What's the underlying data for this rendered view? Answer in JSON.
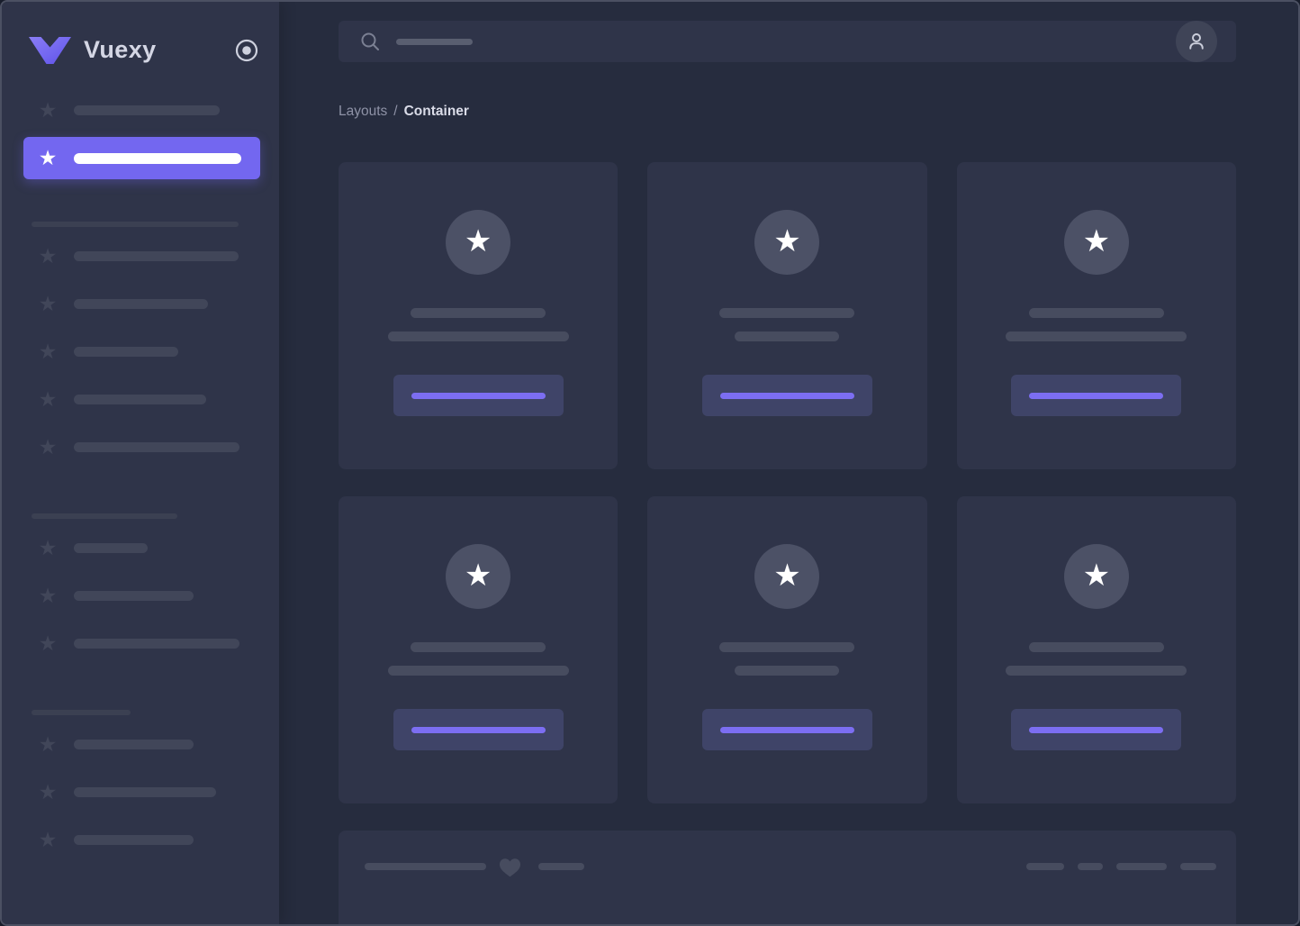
{
  "theme": {
    "accent": "#7367f0",
    "main_bg": "#262c3e",
    "panel_bg": "#2f3449",
    "window_border": "#4b5062",
    "sk_bar": "#414659",
    "sk_bar_dim": "#3b4052",
    "card_bar": "#474c5f",
    "circle_bg": "#4c5166",
    "btn_bg": "#3f4468",
    "btn_bar": "#7c6ef2",
    "avatar_bg": "#3f4457",
    "text_primary": "#d4d6e4",
    "text_muted": "#8e92a6"
  },
  "icons": {
    "star_glyph": "★",
    "brand_logo": "vuexy-v-chevron",
    "sidebar_toggle": "radio-circle",
    "menu_item": "star",
    "search": "magnifier",
    "user": "person-silhouette",
    "footer": "heart"
  },
  "sidebar": {
    "brand": "Vuexy",
    "menu": {
      "top_item_bar_width": 162,
      "active_item_bar_width": 186,
      "sections": [
        {
          "header_bar_width": 230,
          "item_bar_widths": [
            183,
            149,
            116,
            147,
            184
          ]
        },
        {
          "header_bar_width": 162,
          "item_bar_widths": [
            82,
            133,
            184
          ]
        },
        {
          "header_bar_width": 110,
          "item_bar_widths": [
            133,
            158,
            133
          ]
        }
      ]
    }
  },
  "header": {
    "search_placeholder_bar_width": 85
  },
  "breadcrumb": {
    "parent": "Layouts",
    "separator": "/",
    "current": "Container"
  },
  "content": {
    "cards": [
      {
        "icon": "star",
        "title_bar_width": 150,
        "subtitle_bar_width": 201,
        "button_bar_width": 149
      },
      {
        "icon": "star",
        "title_bar_width": 150,
        "subtitle_bar_width": 116,
        "button_bar_width": 149
      },
      {
        "icon": "star",
        "title_bar_width": 150,
        "subtitle_bar_width": 201,
        "button_bar_width": 149
      },
      {
        "icon": "star",
        "title_bar_width": 150,
        "subtitle_bar_width": 201,
        "button_bar_width": 149
      },
      {
        "icon": "star",
        "title_bar_width": 150,
        "subtitle_bar_width": 116,
        "button_bar_width": 149
      },
      {
        "icon": "star",
        "title_bar_width": 150,
        "subtitle_bar_width": 201,
        "button_bar_width": 149
      }
    ]
  },
  "footer": {
    "left_bar_widths": [
      135,
      51
    ],
    "icon": "heart",
    "right_bar_widths": [
      42,
      28,
      56,
      40
    ]
  }
}
